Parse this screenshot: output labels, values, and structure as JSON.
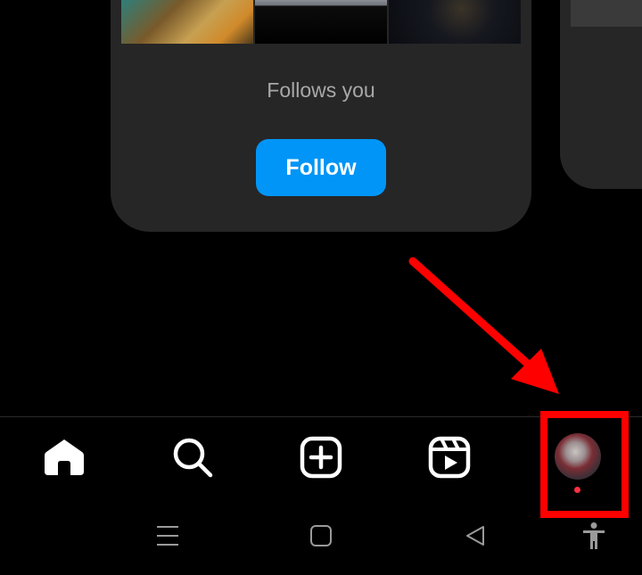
{
  "card": {
    "status_text": "Follows you",
    "follow_label": "Follow"
  },
  "colors": {
    "background": "#000000",
    "card": "#262626",
    "follow_button": "#0095f6",
    "notification_dot": "#ff3040",
    "annotation": "#ff0000"
  },
  "bottom_nav": {
    "items": [
      {
        "name": "home",
        "icon": "home-icon"
      },
      {
        "name": "search",
        "icon": "search-icon"
      },
      {
        "name": "create",
        "icon": "plus-square-icon"
      },
      {
        "name": "reels",
        "icon": "reels-icon"
      },
      {
        "name": "profile",
        "icon": "avatar"
      }
    ]
  },
  "system_nav": {
    "items": [
      "menu-icon",
      "home-square-icon",
      "back-icon",
      "accessibility-icon"
    ]
  },
  "annotation": {
    "type": "arrow-and-box",
    "target": "profile-tab"
  }
}
